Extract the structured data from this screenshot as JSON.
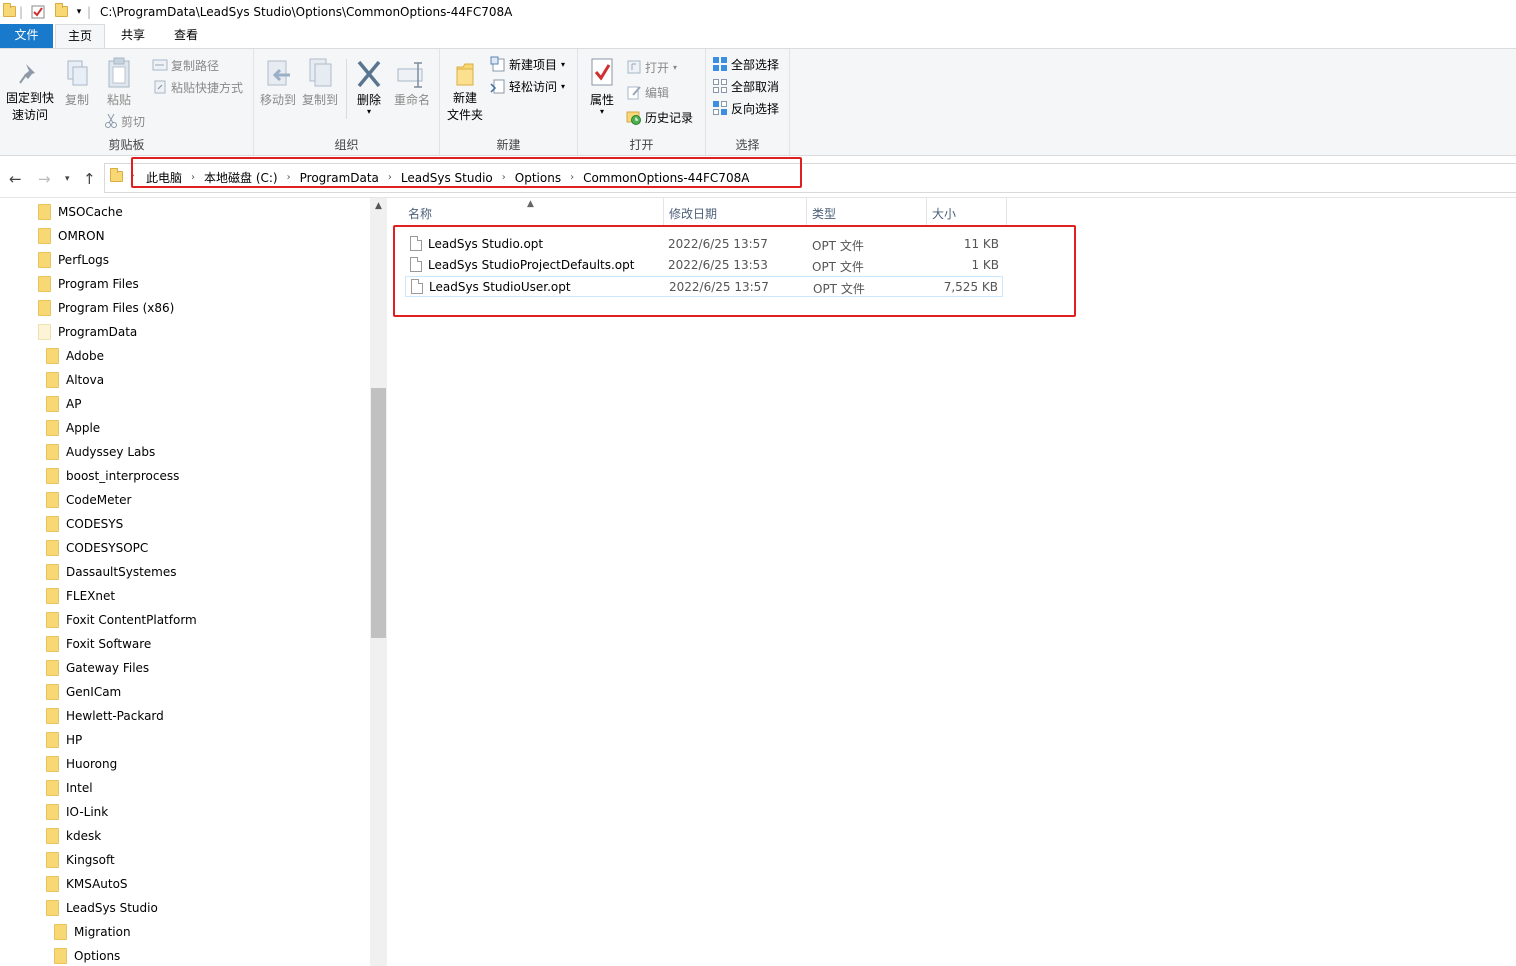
{
  "window": {
    "title_path": "C:\\ProgramData\\LeadSys Studio\\Options\\CommonOptions-44FC708A"
  },
  "tabs": [
    {
      "label": "文件"
    },
    {
      "label": "主页"
    },
    {
      "label": "共享"
    },
    {
      "label": "查看"
    }
  ],
  "ribbon": {
    "clipboard": {
      "pin_label_1": "固定到快",
      "pin_label_2": "速访问",
      "copy": "复制",
      "paste": "粘贴",
      "copy_path": "复制路径",
      "paste_shortcut": "粘贴快捷方式",
      "cut": "剪切",
      "group": "剪贴板"
    },
    "organize": {
      "move_to": "移动到",
      "copy_to": "复制到",
      "delete": "删除",
      "rename": "重命名",
      "group": "组织"
    },
    "new": {
      "new_folder_1": "新建",
      "new_folder_2": "文件夹",
      "new_item": "新建项目",
      "easy_access": "轻松访问",
      "group": "新建"
    },
    "open": {
      "properties": "属性",
      "open": "打开",
      "edit": "编辑",
      "history": "历史记录",
      "group": "打开"
    },
    "select": {
      "select_all": "全部选择",
      "select_none": "全部取消",
      "invert": "反向选择",
      "group": "选择"
    }
  },
  "breadcrumb": [
    "此电脑",
    "本地磁盘 (C:)",
    "ProgramData",
    "LeadSys Studio",
    "Options",
    "CommonOptions-44FC708A"
  ],
  "tree": [
    {
      "label": "MSOCache",
      "indent": 0
    },
    {
      "label": "OMRON",
      "indent": 0
    },
    {
      "label": "PerfLogs",
      "indent": 0
    },
    {
      "label": "Program Files",
      "indent": 0
    },
    {
      "label": "Program Files (x86)",
      "indent": 0
    },
    {
      "label": "ProgramData",
      "indent": 0,
      "open": true
    },
    {
      "label": "Adobe",
      "indent": 1
    },
    {
      "label": "Altova",
      "indent": 1
    },
    {
      "label": "AP",
      "indent": 1
    },
    {
      "label": "Apple",
      "indent": 1
    },
    {
      "label": "Audyssey Labs",
      "indent": 1
    },
    {
      "label": "boost_interprocess",
      "indent": 1
    },
    {
      "label": "CodeMeter",
      "indent": 1
    },
    {
      "label": "CODESYS",
      "indent": 1
    },
    {
      "label": "CODESYSOPC",
      "indent": 1
    },
    {
      "label": "DassaultSystemes",
      "indent": 1
    },
    {
      "label": "FLEXnet",
      "indent": 1
    },
    {
      "label": "Foxit ContentPlatform",
      "indent": 1
    },
    {
      "label": "Foxit Software",
      "indent": 1
    },
    {
      "label": "Gateway Files",
      "indent": 1
    },
    {
      "label": "GenICam",
      "indent": 1
    },
    {
      "label": "Hewlett-Packard",
      "indent": 1
    },
    {
      "label": "HP",
      "indent": 1
    },
    {
      "label": "Huorong",
      "indent": 1
    },
    {
      "label": "Intel",
      "indent": 1
    },
    {
      "label": "IO-Link",
      "indent": 1
    },
    {
      "label": "kdesk",
      "indent": 1
    },
    {
      "label": "Kingsoft",
      "indent": 1
    },
    {
      "label": "KMSAutoS",
      "indent": 1
    },
    {
      "label": "LeadSys Studio",
      "indent": 1
    },
    {
      "label": "Migration",
      "indent": 2
    },
    {
      "label": "Options",
      "indent": 2
    }
  ],
  "columns": {
    "name": "名称",
    "date": "修改日期",
    "type": "类型",
    "size": "大小"
  },
  "files": [
    {
      "name": "LeadSys Studio.opt",
      "date": "2022/6/25 13:57",
      "type": "OPT 文件",
      "size": "11 KB"
    },
    {
      "name": "LeadSys StudioProjectDefaults.opt",
      "date": "2022/6/25 13:53",
      "type": "OPT 文件",
      "size": "1 KB"
    },
    {
      "name": "LeadSys StudioUser.opt",
      "date": "2022/6/25 13:57",
      "type": "OPT 文件",
      "size": "7,525 KB"
    }
  ],
  "colors": {
    "file_tab": "#1979ca",
    "highlight_box": "#e02020",
    "folder": "#f8d775"
  }
}
